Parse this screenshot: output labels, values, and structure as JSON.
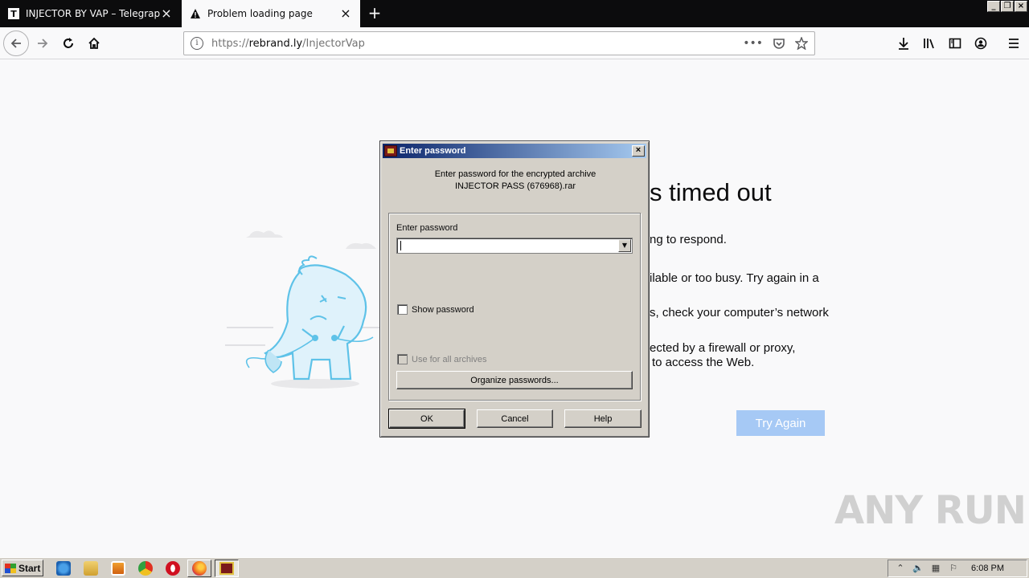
{
  "browser": {
    "tabs": [
      {
        "label": "INJECTOR BY VAP – Telegraph",
        "favicon": "T"
      },
      {
        "label": "Problem loading page",
        "favicon": "warning-icon"
      }
    ],
    "url": "https://rebrand.ly/InjectorVap",
    "url_prefix": "https://",
    "url_host": "rebrand.ly",
    "url_path": "/InjectorVap"
  },
  "error_page": {
    "title_visible": "s timed out",
    "line1": "ng to respond.",
    "line2": "ilable or too busy. Try again in a",
    "line3": "s, check your computer’s network",
    "line4a": "ected by a firewall or proxy,",
    "line4b": "to access the Web.",
    "try_again_label": "Try Again"
  },
  "dialog": {
    "title": "Enter password",
    "message_line1": "Enter password for the encrypted archive",
    "message_line2": "INJECTOR PASS (676968).rar",
    "password_label": "Enter password",
    "password_value": "",
    "show_password_label": "Show password",
    "use_for_all_label": "Use for all archives",
    "organize_label": "Organize passwords...",
    "ok_label": "OK",
    "cancel_label": "Cancel",
    "help_label": "Help"
  },
  "taskbar": {
    "start_label": "Start",
    "clock": "6:08 PM"
  },
  "watermark": "ANY RUN",
  "colors": {
    "try_again": "#a6c9f5",
    "title_gradient_start": "#0a246a",
    "title_gradient_end": "#a6caf0",
    "dino": "#5ec2e8"
  }
}
